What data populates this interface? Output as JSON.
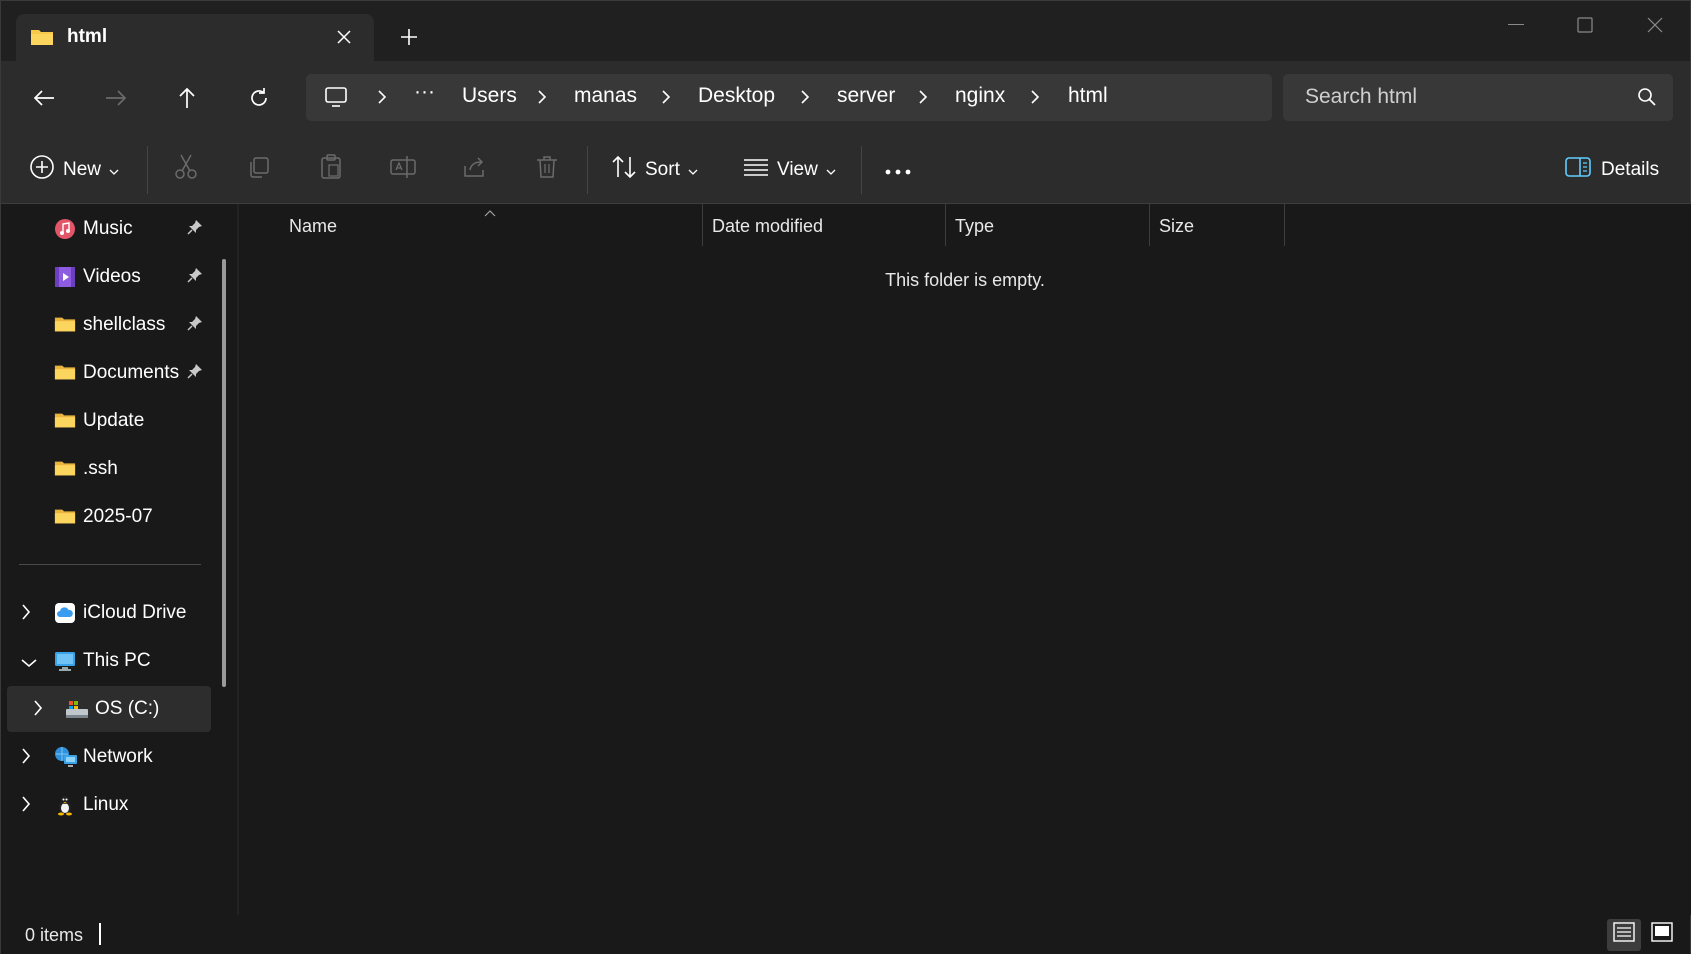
{
  "tab": {
    "title": "html",
    "close_label": "✕",
    "new_tab_label": "+"
  },
  "window_controls": {
    "minimize": "—",
    "maximize": "☐",
    "close": "✕"
  },
  "breadcrumb": {
    "overflow": "···",
    "items": [
      "Users",
      "manas",
      "Desktop",
      "server",
      "nginx",
      "html"
    ]
  },
  "search": {
    "placeholder": "Search html"
  },
  "toolbar": {
    "new_label": "New",
    "sort_label": "Sort",
    "view_label": "View",
    "more_label": "•••",
    "details_label": "Details"
  },
  "sidebar": {
    "quick_access": [
      {
        "label": "Music",
        "icon": "music-icon",
        "pinned": true
      },
      {
        "label": "Videos",
        "icon": "videos-icon",
        "pinned": true
      },
      {
        "label": "shellclass",
        "icon": "folder-icon",
        "pinned": true
      },
      {
        "label": "Documents",
        "icon": "folder-icon",
        "pinned": true
      },
      {
        "label": "Update",
        "icon": "folder-icon",
        "pinned": false
      },
      {
        "label": ".ssh",
        "icon": "folder-icon",
        "pinned": false
      },
      {
        "label": "2025-07",
        "icon": "folder-icon",
        "pinned": false
      }
    ],
    "tree": [
      {
        "label": "iCloud Drive",
        "icon": "icloud-icon",
        "expanded": false
      },
      {
        "label": "This PC",
        "icon": "computer-icon",
        "expanded": true
      },
      {
        "label": "OS (C:)",
        "icon": "drive-icon",
        "expanded": false,
        "selected": true
      },
      {
        "label": "Network",
        "icon": "network-icon",
        "expanded": false
      },
      {
        "label": "Linux",
        "icon": "linux-icon",
        "expanded": false
      }
    ]
  },
  "columns": [
    "Name",
    "Date modified",
    "Type",
    "Size"
  ],
  "content": {
    "empty_message": "This folder is empty."
  },
  "status": {
    "items_count": "0 items"
  },
  "colors": {
    "accent": "#60cdff",
    "folder": "#f8c84a"
  }
}
